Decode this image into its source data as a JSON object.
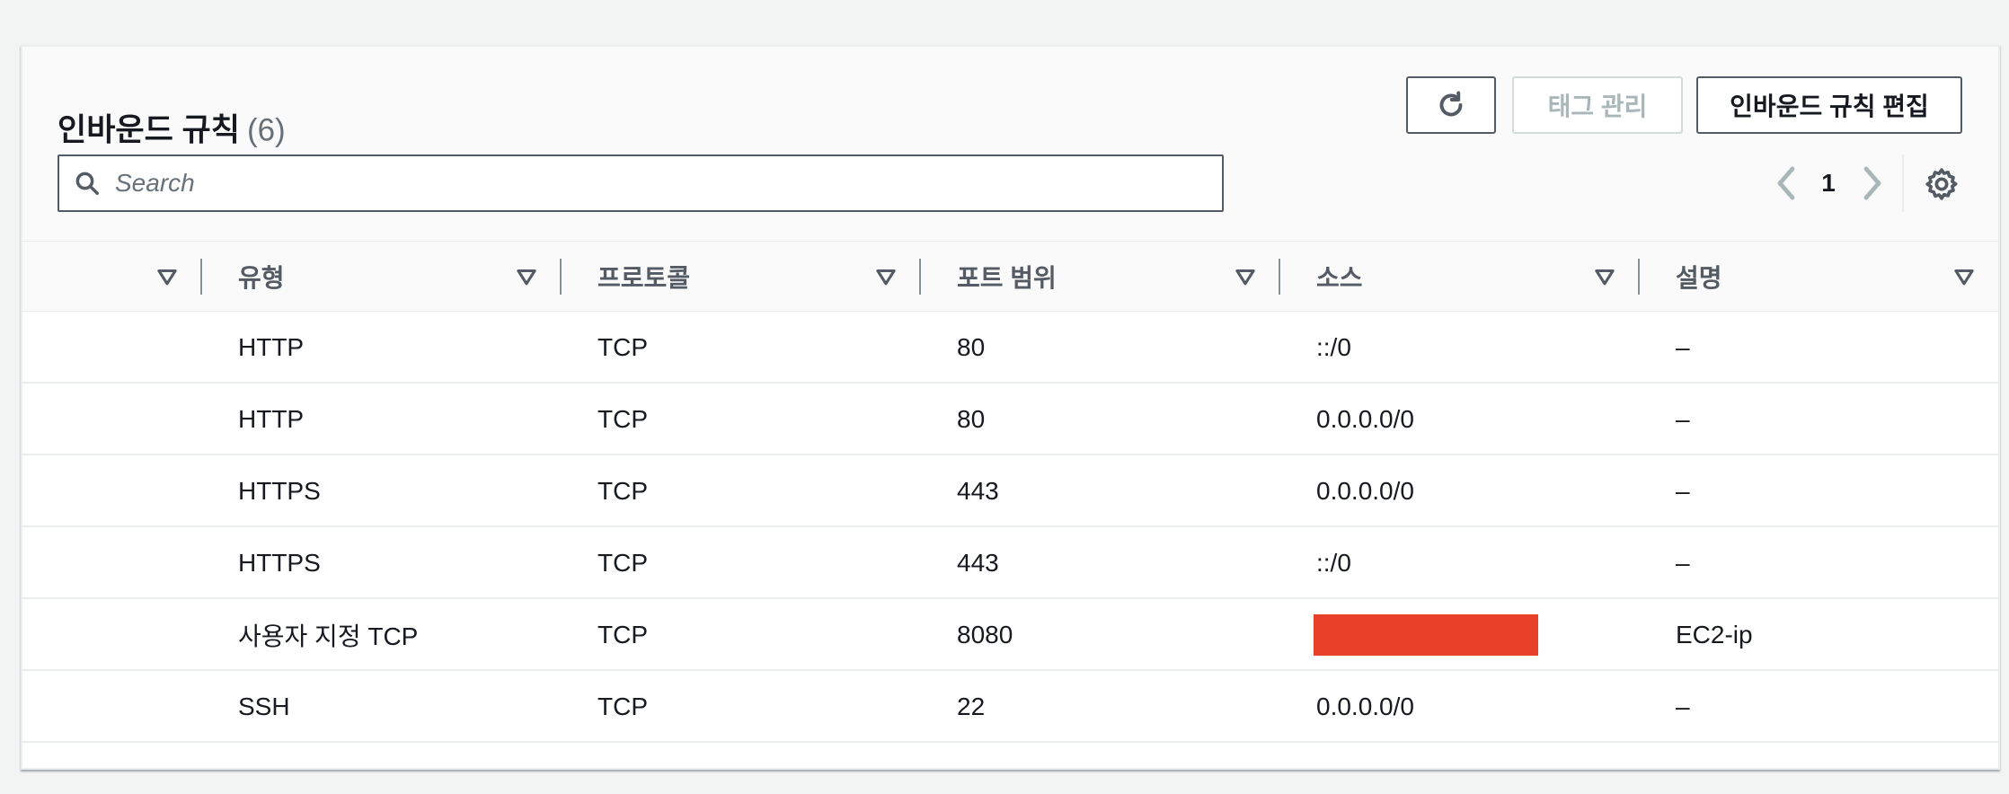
{
  "header": {
    "title": "인바운드 규칙",
    "count": "(6)",
    "refresh_icon": "refresh-icon",
    "tags_button": "태그 관리",
    "edit_button": "인바운드 규칙 편집"
  },
  "search": {
    "placeholder": "Search",
    "icon": "search-icon"
  },
  "pagination": {
    "current_page": "1",
    "prev_icon": "chevron-left-icon",
    "next_icon": "chevron-right-icon",
    "settings_icon": "gear-icon"
  },
  "table": {
    "columns": [
      "유형",
      "프로토콜",
      "포트 범위",
      "소스",
      "설명"
    ],
    "rows": [
      {
        "type": "HTTP",
        "protocol": "TCP",
        "port_range": "80",
        "source": "::/0",
        "description": "–"
      },
      {
        "type": "HTTP",
        "protocol": "TCP",
        "port_range": "80",
        "source": "0.0.0.0/0",
        "description": "–"
      },
      {
        "type": "HTTPS",
        "protocol": "TCP",
        "port_range": "443",
        "source": "0.0.0.0/0",
        "description": "–"
      },
      {
        "type": "HTTPS",
        "protocol": "TCP",
        "port_range": "443",
        "source": "::/0",
        "description": "–"
      },
      {
        "type": "사용자 지정 TCP",
        "protocol": "TCP",
        "port_range": "8080",
        "source": "",
        "description": "EC2-ip"
      },
      {
        "type": "SSH",
        "protocol": "TCP",
        "port_range": "22",
        "source": "0.0.0.0/0",
        "description": "–"
      }
    ]
  },
  "colors": {
    "redaction": "#e8412a",
    "border": "#545b64",
    "disabled": "#aab7b8"
  }
}
